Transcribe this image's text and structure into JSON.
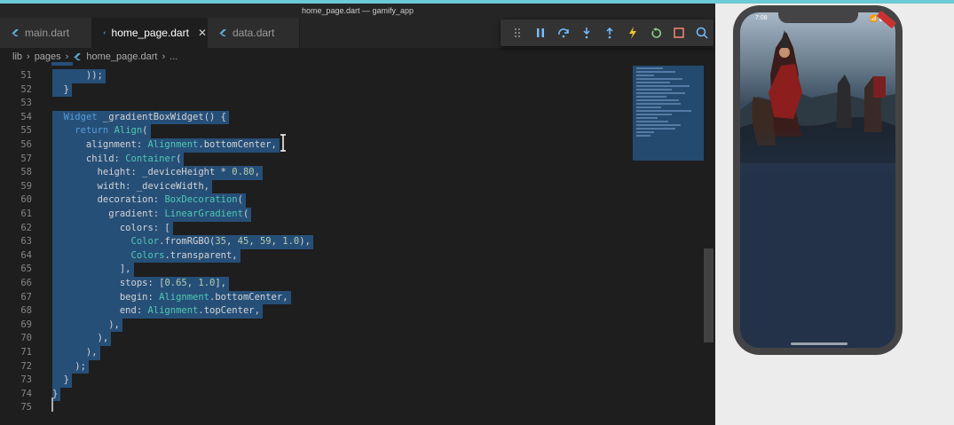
{
  "window": {
    "title": "home_page.dart — gamify_app"
  },
  "tabs": [
    {
      "label": "main.dart",
      "active": false
    },
    {
      "label": "home_page.dart",
      "active": true,
      "close": "✕"
    },
    {
      "label": "data.dart",
      "active": false
    }
  ],
  "breadcrumb": [
    "lib",
    "pages",
    "home_page.dart",
    "..."
  ],
  "debug_toolbar": [
    "drag-handle",
    "pause",
    "step-over",
    "step-into",
    "step-out",
    "hot-reload",
    "hot-restart",
    "stop",
    "inspect"
  ],
  "code_lines": [
    {
      "n": "51",
      "t": "      ));"
    },
    {
      "n": "52",
      "t": "  }"
    },
    {
      "n": "53",
      "t": ""
    },
    {
      "n": "54",
      "t": "  Widget _gradientBoxWidget() {"
    },
    {
      "n": "55",
      "t": "    return Align("
    },
    {
      "n": "56",
      "t": "      alignment: Alignment.bottomCenter,"
    },
    {
      "n": "57",
      "t": "      child: Container("
    },
    {
      "n": "58",
      "t": "        height: _deviceHeight * 0.80,"
    },
    {
      "n": "59",
      "t": "        width: _deviceWidth,"
    },
    {
      "n": "60",
      "t": "        decoration: BoxDecoration("
    },
    {
      "n": "61",
      "t": "          gradient: LinearGradient("
    },
    {
      "n": "62",
      "t": "            colors: ["
    },
    {
      "n": "63",
      "t": "              Color.fromRGBO(35, 45, 59, 1.0),"
    },
    {
      "n": "64",
      "t": "              Colors.transparent,"
    },
    {
      "n": "65",
      "t": "            ],"
    },
    {
      "n": "66",
      "t": "            stops: [0.65, 1.0],"
    },
    {
      "n": "67",
      "t": "            begin: Alignment.bottomCenter,"
    },
    {
      "n": "68",
      "t": "            end: Alignment.topCenter,"
    },
    {
      "n": "69",
      "t": "          ),"
    },
    {
      "n": "70",
      "t": "        ),"
    },
    {
      "n": "71",
      "t": "      ),"
    },
    {
      "n": "72",
      "t": "    );"
    },
    {
      "n": "73",
      "t": "  }"
    },
    {
      "n": "74",
      "t": "}"
    },
    {
      "n": "75",
      "t": ""
    }
  ],
  "simulator": {
    "time": "7:08",
    "status_icons": "📶 ▮",
    "ribbon": "DEBUG"
  },
  "colors": {
    "editor_bg": "#1e1e1e",
    "selection": "#264f78",
    "keyword": "#569cd6",
    "type": "#4ec9b0",
    "number": "#b5cea8",
    "app_bg": "#233248"
  }
}
